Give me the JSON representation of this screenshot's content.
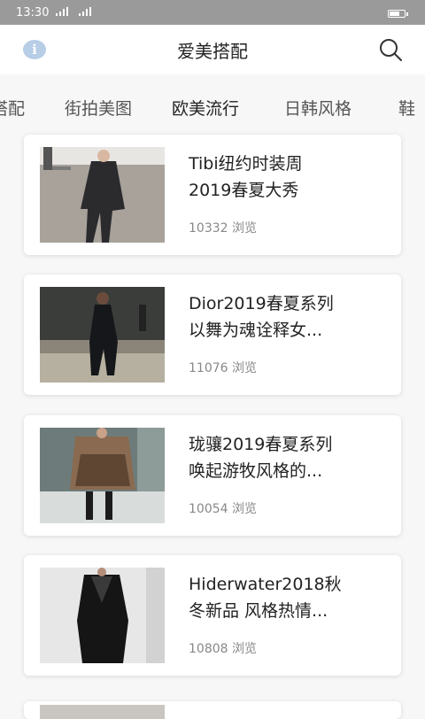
{
  "status_bar": {
    "time": "13:30",
    "signal_1": "ᵀ",
    "signal_2": "ᵀ"
  },
  "header": {
    "title": "爱美搭配",
    "info_icon": "info-icon",
    "search_icon": "search-icon"
  },
  "tabs": [
    {
      "label": "搭配"
    },
    {
      "label": "街拍美图"
    },
    {
      "label": "欧美流行",
      "active": true
    },
    {
      "label": "日韩风格"
    },
    {
      "label": "鞋"
    }
  ],
  "articles": [
    {
      "title": "Tibi纽约时装周\n2019春夏大秀",
      "views": "10332 浏览"
    },
    {
      "title": "Dior2019春夏系列\n以舞为魂诠释女...",
      "views": "11076 浏览"
    },
    {
      "title": "珑骧2019春夏系列\n唤起游牧风格的...",
      "views": "10054 浏览"
    },
    {
      "title": "Hiderwater2018秋\n冬新品 风格热情...",
      "views": "10808 浏览"
    }
  ],
  "colors": {
    "status_bar": "#9a9a9a",
    "info_icon": "#b8cde6",
    "background": "#f7f7f7"
  }
}
